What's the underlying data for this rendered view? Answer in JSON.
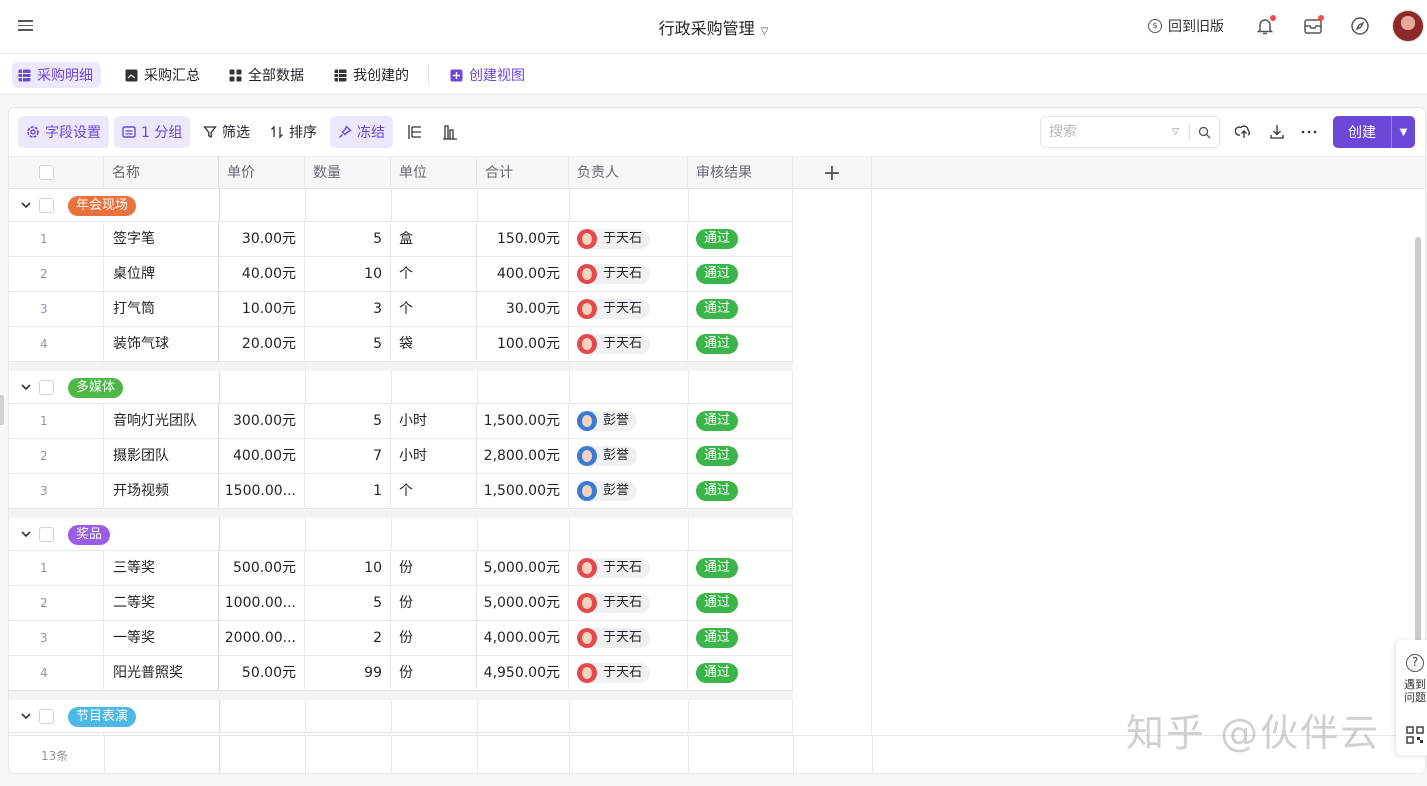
{
  "app": {
    "title": "行政采购管理",
    "back_to_old": "回到旧版"
  },
  "view_tabs": [
    {
      "label": "采购明细",
      "active": true,
      "icon": "grid-icon"
    },
    {
      "label": "采购汇总",
      "active": false,
      "icon": "gallery-icon"
    },
    {
      "label": "全部数据",
      "active": false,
      "icon": "kanban-icon"
    },
    {
      "label": "我创建的",
      "active": false,
      "icon": "grid-icon"
    },
    {
      "label": "创建视图",
      "active": false,
      "icon": "plus-square-icon"
    }
  ],
  "toolbar": {
    "field_settings": "字段设置",
    "group": "1 分组",
    "filter": "筛选",
    "sort": "排序",
    "freeze": "冻结",
    "search_placeholder": "搜索",
    "create": "创建"
  },
  "columns": [
    "名称",
    "单价",
    "数量",
    "单位",
    "合计",
    "负责人",
    "审核结果"
  ],
  "groups": [
    {
      "name": "年会现场",
      "color": "#e8713c",
      "rows": [
        {
          "idx": "1",
          "name": "签字笔",
          "price": "30.00元",
          "qty": "5",
          "unit": "盒",
          "total": "150.00元",
          "person": "于天石",
          "avatar": "red",
          "review": "通过"
        },
        {
          "idx": "2",
          "name": "桌位牌",
          "price": "40.00元",
          "qty": "10",
          "unit": "个",
          "total": "400.00元",
          "person": "于天石",
          "avatar": "red",
          "review": "通过"
        },
        {
          "idx": "3",
          "name": "打气筒",
          "price": "10.00元",
          "qty": "3",
          "unit": "个",
          "total": "30.00元",
          "person": "于天石",
          "avatar": "red",
          "review": "通过"
        },
        {
          "idx": "4",
          "name": "装饰气球",
          "price": "20.00元",
          "qty": "5",
          "unit": "袋",
          "total": "100.00元",
          "person": "于天石",
          "avatar": "red",
          "review": "通过"
        }
      ]
    },
    {
      "name": "多媒体",
      "color": "#4db848",
      "rows": [
        {
          "idx": "1",
          "name": "音响灯光团队",
          "price": "300.00元",
          "qty": "5",
          "unit": "小时",
          "total": "1,500.00元",
          "person": "彭誉",
          "avatar": "blue",
          "review": "通过"
        },
        {
          "idx": "2",
          "name": "摄影团队",
          "price": "400.00元",
          "qty": "7",
          "unit": "小时",
          "total": "2,800.00元",
          "person": "彭誉",
          "avatar": "blue",
          "review": "通过"
        },
        {
          "idx": "3",
          "name": "开场视频",
          "price": "1500.00...",
          "qty": "1",
          "unit": "个",
          "total": "1,500.00元",
          "person": "彭誉",
          "avatar": "blue",
          "review": "通过"
        }
      ]
    },
    {
      "name": "奖品",
      "color": "#9a5ce6",
      "rows": [
        {
          "idx": "1",
          "name": "三等奖",
          "price": "500.00元",
          "qty": "10",
          "unit": "份",
          "total": "5,000.00元",
          "person": "于天石",
          "avatar": "red",
          "review": "通过"
        },
        {
          "idx": "2",
          "name": "二等奖",
          "price": "1000.00...",
          "qty": "5",
          "unit": "份",
          "total": "5,000.00元",
          "person": "于天石",
          "avatar": "red",
          "review": "通过"
        },
        {
          "idx": "3",
          "name": "一等奖",
          "price": "2000.00...",
          "qty": "2",
          "unit": "份",
          "total": "4,000.00元",
          "person": "于天石",
          "avatar": "red",
          "review": "通过"
        },
        {
          "idx": "4",
          "name": "阳光普照奖",
          "price": "50.00元",
          "qty": "99",
          "unit": "份",
          "total": "4,950.00元",
          "person": "于天石",
          "avatar": "red",
          "review": "通过"
        }
      ]
    },
    {
      "name": "节目表演",
      "color": "#4db8e6",
      "rows": []
    }
  ],
  "footer": {
    "count": "13条"
  },
  "help": {
    "text": "遇到问题"
  },
  "watermark": "知乎 @伙伴云"
}
